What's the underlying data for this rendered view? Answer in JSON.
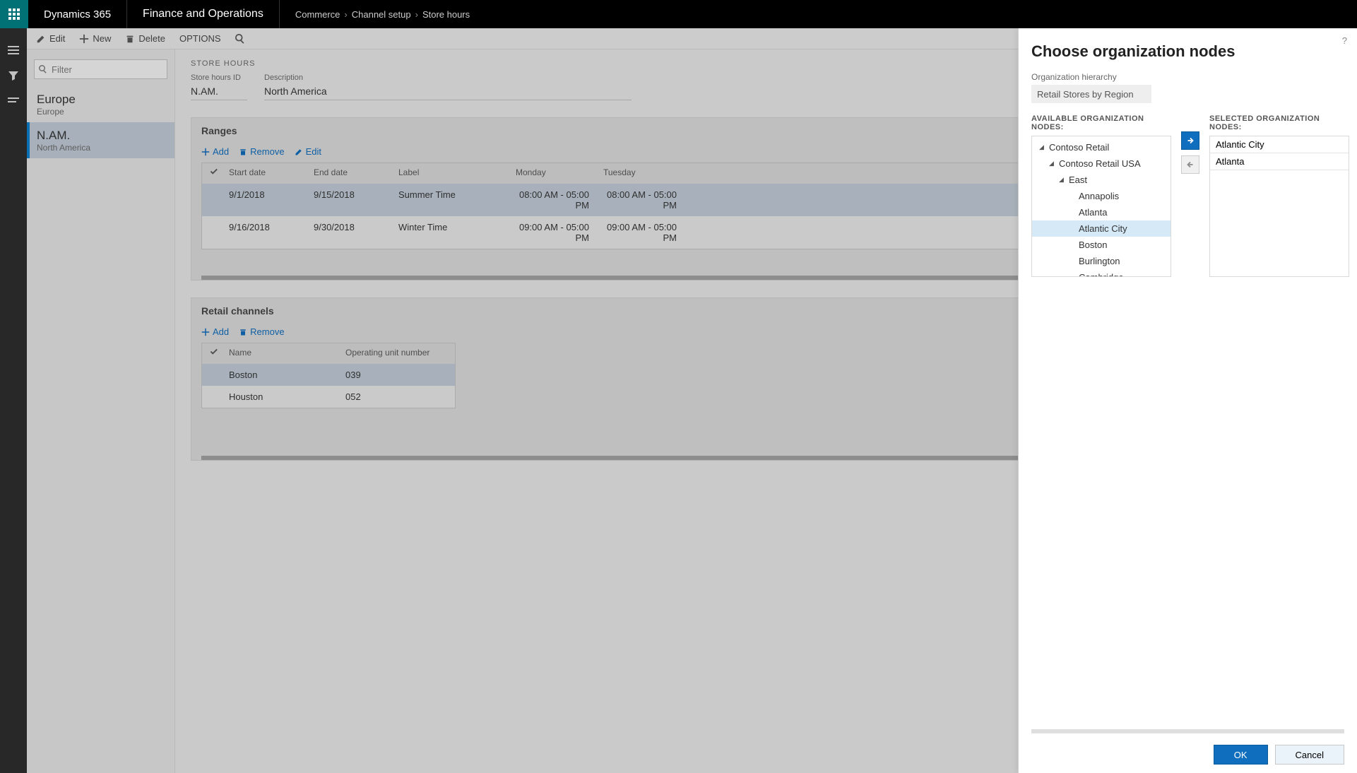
{
  "header": {
    "brand": "Dynamics 365",
    "module": "Finance and Operations",
    "breadcrumb": [
      "Commerce",
      "Channel setup",
      "Store hours"
    ]
  },
  "actionbar": {
    "edit": "Edit",
    "new": "New",
    "delete": "Delete",
    "options": "OPTIONS"
  },
  "filter_placeholder": "Filter",
  "list": [
    {
      "title": "Europe",
      "sub": "Europe",
      "selected": false
    },
    {
      "title": "N.AM.",
      "sub": "North America",
      "selected": true
    }
  ],
  "page_header": "STORE HOURS",
  "fields": {
    "id_label": "Store hours ID",
    "id_value": "N.AM.",
    "desc_label": "Description",
    "desc_value": "North America"
  },
  "ranges": {
    "title": "Ranges",
    "tools": {
      "add": "Add",
      "remove": "Remove",
      "edit": "Edit"
    },
    "columns": [
      "Start date",
      "End date",
      "Label",
      "Monday",
      "Tuesday"
    ],
    "rows": [
      {
        "start": "9/1/2018",
        "end": "9/15/2018",
        "label": "Summer Time",
        "mon": "08:00 AM - 05:00 PM",
        "tue": "08:00 AM - 05:00 PM",
        "selected": true
      },
      {
        "start": "9/16/2018",
        "end": "9/30/2018",
        "label": "Winter Time",
        "mon": "09:00 AM - 05:00 PM",
        "tue": "09:00 AM - 05:00 PM",
        "selected": false
      }
    ]
  },
  "channels": {
    "title": "Retail channels",
    "tools": {
      "add": "Add",
      "remove": "Remove"
    },
    "columns": [
      "Name",
      "Operating unit number"
    ],
    "rows": [
      {
        "name": "Boston",
        "num": "039",
        "selected": true
      },
      {
        "name": "Houston",
        "num": "052",
        "selected": false
      }
    ]
  },
  "flyout": {
    "title": "Choose organization nodes",
    "hierarchy_label": "Organization hierarchy",
    "hierarchy_value": "Retail Stores by Region",
    "available_label": "AVAILABLE ORGANIZATION NODES:",
    "selected_label": "SELECTED ORGANIZATION NODES:",
    "tree": [
      {
        "indent": 0,
        "expand": true,
        "label": "Contoso Retail"
      },
      {
        "indent": 1,
        "expand": true,
        "label": "Contoso Retail USA"
      },
      {
        "indent": 2,
        "expand": true,
        "label": "East"
      },
      {
        "indent": 3,
        "expand": false,
        "label": "Annapolis"
      },
      {
        "indent": 3,
        "expand": false,
        "label": "Atlanta"
      },
      {
        "indent": 3,
        "expand": false,
        "label": "Atlantic City",
        "selected": true
      },
      {
        "indent": 3,
        "expand": false,
        "label": "Boston"
      },
      {
        "indent": 3,
        "expand": false,
        "label": "Burlington"
      },
      {
        "indent": 3,
        "expand": false,
        "label": "Cambridge"
      }
    ],
    "selected_nodes": [
      "Atlantic City",
      "Atlanta"
    ],
    "ok": "OK",
    "cancel": "Cancel",
    "help": "?"
  }
}
